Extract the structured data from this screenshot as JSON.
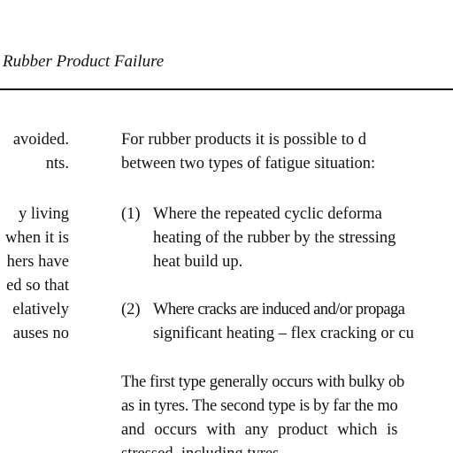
{
  "header": {
    "title": "Rubber Product Failure"
  },
  "left_column": {
    "lines": [
      "avoided.",
      "nts.",
      "y living",
      "when it is",
      "hers have",
      "ed so that",
      "elatively",
      "auses no"
    ]
  },
  "right_column": {
    "intro_lines": [
      "For rubber products it is possible to d",
      "between two types of fatigue situation:"
    ],
    "items": [
      {
        "number": "(1)",
        "lines": [
          "Where the repeated cyclic deforma",
          "heating of the rubber by the stressing",
          "heat build up."
        ]
      },
      {
        "number": "(2)",
        "lines": [
          "Where cracks are induced and/or propaga",
          "significant heating – flex cracking or cu"
        ]
      }
    ],
    "closing_lines": [
      "The first type generally occurs with bulky ob",
      "as in tyres. The second type is by far the mo",
      "and occurs with any product which is",
      "stressed, including tyres."
    ]
  }
}
